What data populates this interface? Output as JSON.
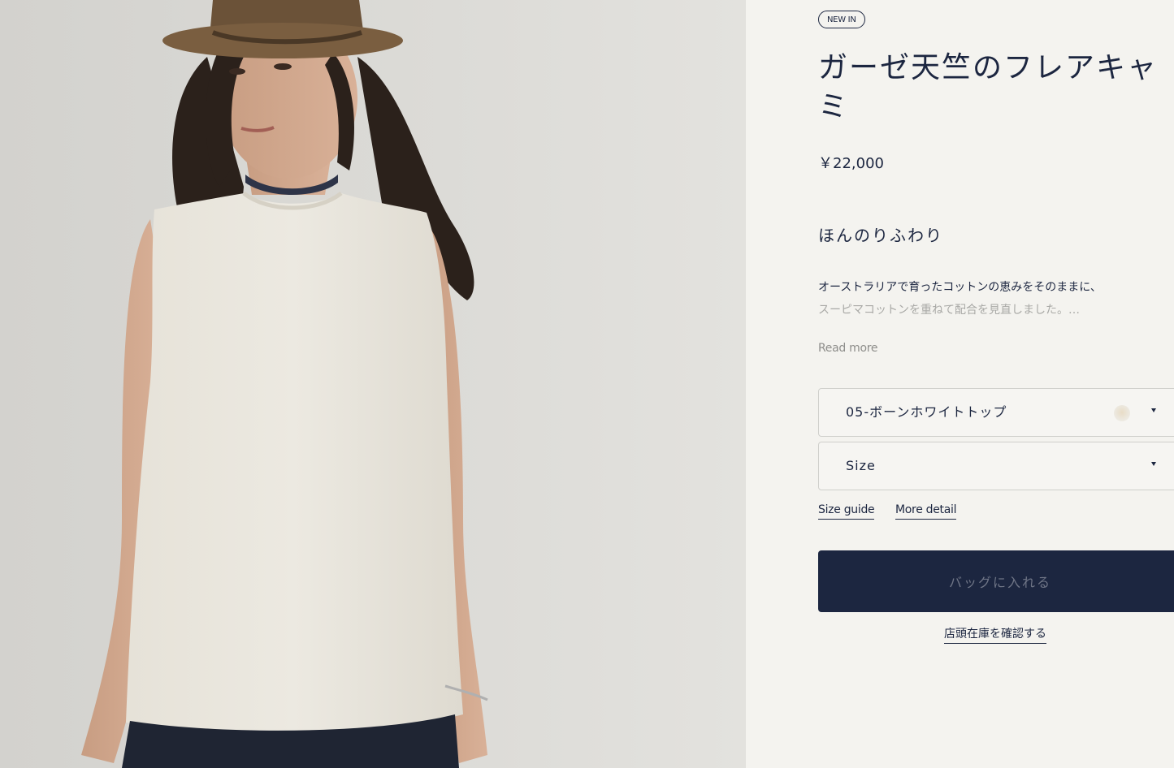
{
  "product": {
    "badge": "NEW IN",
    "title": "ガーゼ天竺のフレアキャミ",
    "price": "￥22,000",
    "tagline": "ほんのりふわり",
    "description_line1": "オーストラリアで育ったコットンの恵みをそのままに、",
    "description_line2": "スーピマコットンを重ねて配合を見直しました。…",
    "read_more_label": "Read more"
  },
  "options": {
    "color_selected": "05-ボーンホワイトトップ",
    "size_placeholder": "Size"
  },
  "links": {
    "size_guide": "Size guide",
    "more_detail": "More detail"
  },
  "actions": {
    "add_to_bag": "バッグに入れる",
    "check_store_stock": "店頭在庫を確認する"
  },
  "colors": {
    "navy": "#1c2640",
    "background": "#f4f3ef"
  }
}
